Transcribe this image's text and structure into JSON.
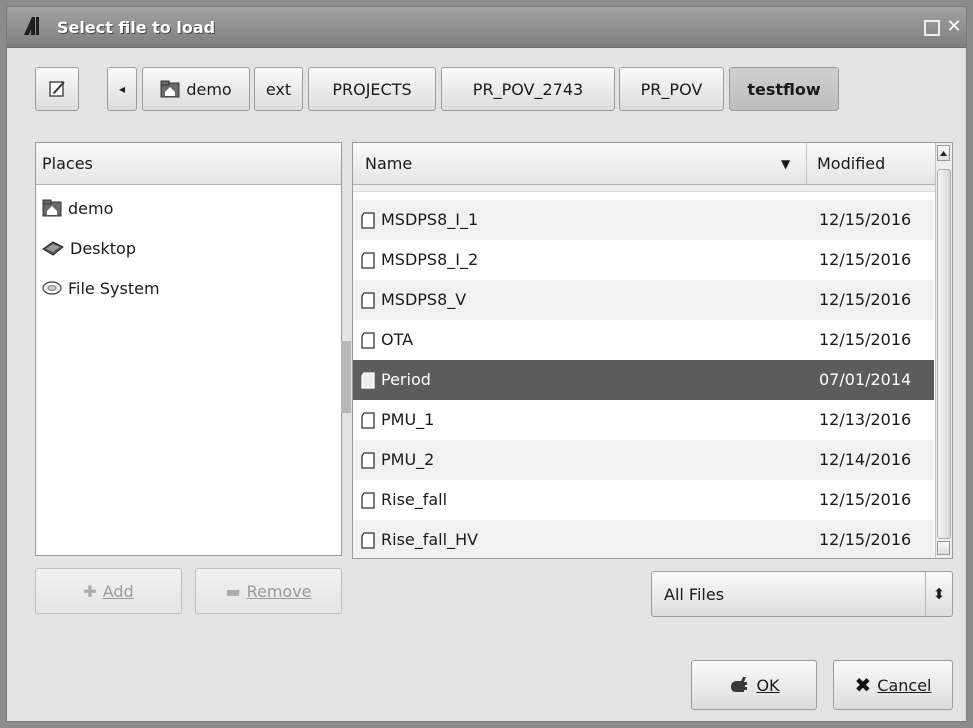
{
  "window": {
    "title": "Select file to load"
  },
  "pathbar": {
    "back_symbol": "◂",
    "crumbs": [
      {
        "label": "demo"
      },
      {
        "label": "ext"
      },
      {
        "label": "PROJECTS"
      },
      {
        "label": "PR_POV_2743"
      },
      {
        "label": "PR_POV"
      },
      {
        "label": "testflow"
      }
    ],
    "active_crumb": "testflow"
  },
  "places": {
    "header": "Places",
    "items": [
      {
        "label": "demo",
        "icon": "home-icon"
      },
      {
        "label": "Desktop",
        "icon": "desktop-icon"
      },
      {
        "label": "File System",
        "icon": "drive-icon"
      }
    ],
    "add_label": "Add",
    "remove_label": "Remove"
  },
  "files": {
    "col_name": "Name",
    "col_modified": "Modified",
    "sort_indicator": "▼",
    "rows": [
      {
        "name": "MSDPS8_I_1",
        "modified": "12/15/2016"
      },
      {
        "name": "MSDPS8_I_2",
        "modified": "12/15/2016"
      },
      {
        "name": "MSDPS8_V",
        "modified": "12/15/2016"
      },
      {
        "name": "OTA",
        "modified": "12/15/2016"
      },
      {
        "name": "Period",
        "modified": "07/01/2014",
        "selected": true
      },
      {
        "name": "PMU_1",
        "modified": "12/13/2016"
      },
      {
        "name": "PMU_2",
        "modified": "12/14/2016"
      },
      {
        "name": "Rise_fall",
        "modified": "12/15/2016"
      },
      {
        "name": "Rise_fall_HV",
        "modified": "12/15/2016"
      }
    ]
  },
  "filter": {
    "value": "All Files",
    "spinner": "⬍"
  },
  "actions": {
    "ok_label": "OK",
    "cancel_label": "Cancel"
  },
  "colors": {
    "selected_row": "#5c5c5c",
    "title_bar": "#8f8f8f",
    "dialog_bg": "#e3e3e3"
  }
}
